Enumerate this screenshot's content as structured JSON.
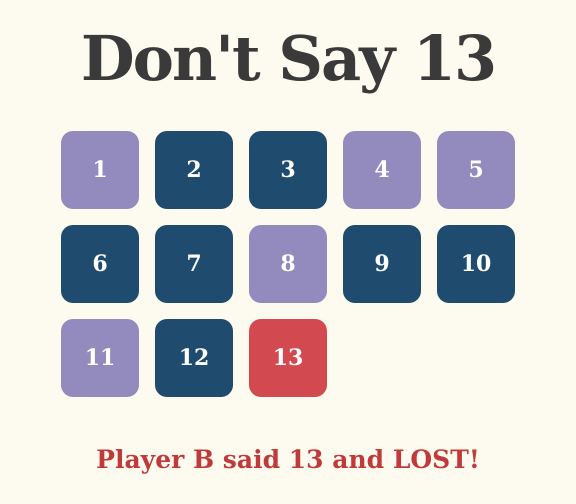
{
  "title": "Don't Say 13",
  "colors": {
    "background": "#fdfbf0",
    "player_a_tile": "#938bbd",
    "player_b_tile": "#1f4b6e",
    "losing_tile": "#d24a50",
    "status_text": "#c13a3a",
    "title_text": "#3a3a3a"
  },
  "tiles": [
    {
      "number": "1",
      "player": "A"
    },
    {
      "number": "2",
      "player": "B"
    },
    {
      "number": "3",
      "player": "B"
    },
    {
      "number": "4",
      "player": "A"
    },
    {
      "number": "5",
      "player": "A"
    },
    {
      "number": "6",
      "player": "B"
    },
    {
      "number": "7",
      "player": "B"
    },
    {
      "number": "8",
      "player": "A"
    },
    {
      "number": "9",
      "player": "B"
    },
    {
      "number": "10",
      "player": "B"
    },
    {
      "number": "11",
      "player": "A"
    },
    {
      "number": "12",
      "player": "B"
    },
    {
      "number": "13",
      "player": "lost"
    }
  ],
  "status": "Player B said 13 and LOST!"
}
